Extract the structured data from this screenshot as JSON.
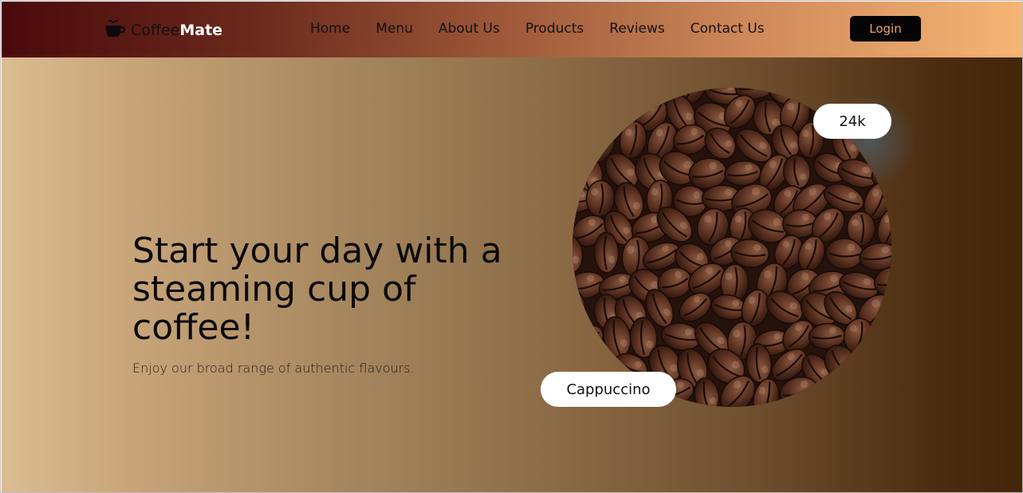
{
  "brand": {
    "part1": "Coffee",
    "part2": "Mate",
    "icon": "coffee-cup-icon"
  },
  "nav": {
    "items": [
      {
        "label": "Home"
      },
      {
        "label": "Menu"
      },
      {
        "label": "About Us"
      },
      {
        "label": "Products"
      },
      {
        "label": "Reviews"
      },
      {
        "label": "Contact Us"
      }
    ]
  },
  "login": {
    "label": "Login"
  },
  "hero": {
    "title": "Start your day with a steaming cup of coffee!",
    "subtitle": "Enjoy our broad range of authentic flavours.",
    "badge_top": "24k",
    "badge_bottom": "Cappuccino",
    "image": "coffee-beans-image"
  },
  "colors": {
    "nav_start": "#4a0a0c",
    "nav_end": "#f6b574",
    "hero_start": "#dbbd92",
    "hero_end": "#43260a",
    "login_bg": "#050505",
    "login_text": "#f1a16a"
  }
}
